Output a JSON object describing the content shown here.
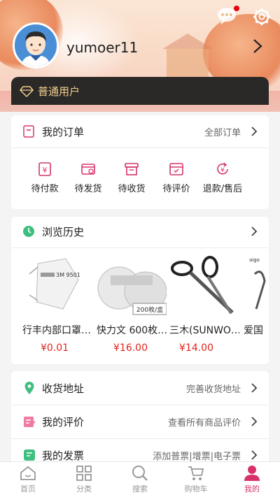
{
  "header": {
    "username": "yumoer11",
    "member_level": "普通用户"
  },
  "orders": {
    "title": "我的订单",
    "all_label": "全部订单",
    "items": [
      {
        "label": "待付款",
        "icon": "wallet-icon"
      },
      {
        "label": "待发货",
        "icon": "truck-icon"
      },
      {
        "label": "待收货",
        "icon": "box-icon"
      },
      {
        "label": "待评价",
        "icon": "review-icon"
      },
      {
        "label": "退款/售后",
        "icon": "refund-icon"
      }
    ]
  },
  "history": {
    "title": "浏览历史",
    "products": [
      {
        "name": "行丰内部口罩…",
        "price": "¥0.01",
        "image_text": "3M 9501"
      },
      {
        "name": "快力文 600枚…",
        "price": "¥16.00",
        "image_text": "200枚/盒"
      },
      {
        "name": "三木(SUNWO…",
        "price": "¥14.00",
        "image_text": ""
      },
      {
        "name": "爱国",
        "price": "",
        "image_text": "aigo"
      }
    ]
  },
  "services": [
    {
      "title": "收货地址",
      "sub": "完善收货地址",
      "icon": "location-icon"
    },
    {
      "title": "我的评价",
      "sub": "查看所有商品评价",
      "icon": "edit-icon"
    },
    {
      "title": "我的发票",
      "sub": "添加普票|增票|电子票",
      "icon": "invoice-icon"
    }
  ],
  "nav": [
    {
      "label": "首页",
      "icon": "home-icon"
    },
    {
      "label": "分类",
      "icon": "category-icon"
    },
    {
      "label": "搜索",
      "icon": "search-icon"
    },
    {
      "label": "购物车",
      "icon": "cart-icon"
    },
    {
      "label": "我的",
      "icon": "user-icon"
    }
  ],
  "colors": {
    "accent": "#d6336c",
    "price": "#e2231a",
    "member_gold": "#f0cf8e",
    "member_bg": "#2b2927"
  }
}
